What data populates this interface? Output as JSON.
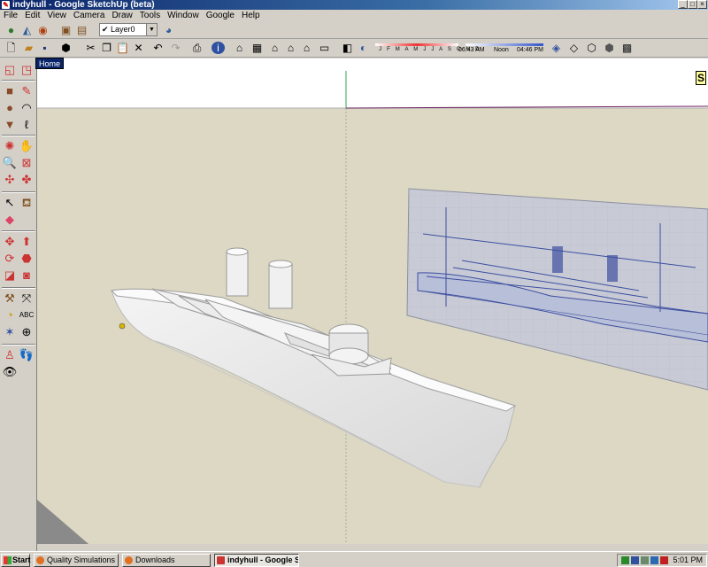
{
  "window": {
    "title": "indyhull - Google SketchUp (beta)"
  },
  "menu": [
    "File",
    "Edit",
    "View",
    "Camera",
    "Draw",
    "Tools",
    "Window",
    "Google",
    "Help"
  ],
  "layer": {
    "current": "Layer0"
  },
  "shadow": {
    "months": "J F M A M J J A S O N D",
    "time_start": "06:43 AM",
    "time_mid": "Noon",
    "time_end": "04:46 PM"
  },
  "tooltip": "Home",
  "scale_tag": "S",
  "taskbar": {
    "start": "Start",
    "tasks": [
      "Quality Simulations Foru...",
      "Downloads",
      "indyhull - Google Sketch..."
    ],
    "clock": "5:01 PM"
  },
  "colors": {
    "titlebar": "#0a246a",
    "background": "#ddd8c3",
    "taskbar": "#d4d0c8"
  }
}
